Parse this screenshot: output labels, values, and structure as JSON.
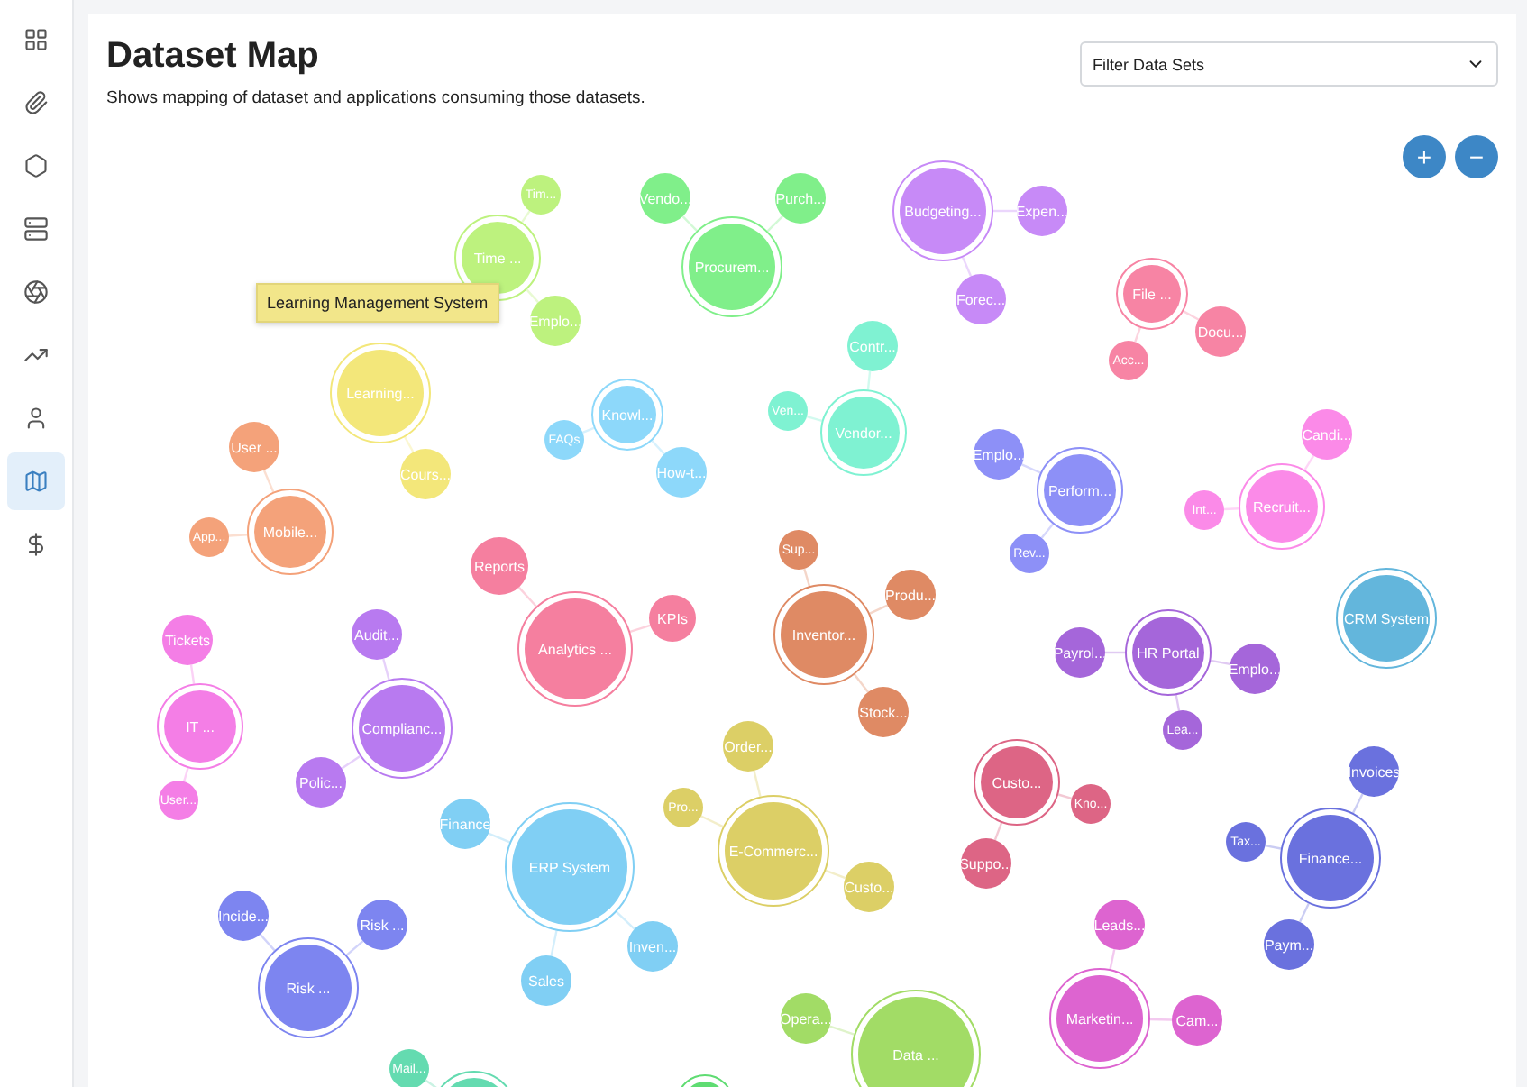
{
  "sidebar": {
    "items": [
      {
        "kind": "grid",
        "selected": false
      },
      {
        "kind": "clip",
        "selected": false
      },
      {
        "kind": "hexagon",
        "selected": false
      },
      {
        "kind": "server",
        "selected": false
      },
      {
        "kind": "aperture",
        "selected": false
      },
      {
        "kind": "trend",
        "selected": false
      },
      {
        "kind": "user",
        "selected": false
      },
      {
        "kind": "map",
        "selected": true
      },
      {
        "kind": "dollar",
        "selected": false
      }
    ]
  },
  "header": {
    "title": "Dataset Map",
    "subtitle": "Shows mapping of dataset and applications consuming those datasets."
  },
  "filter": {
    "placeholder": "Filter Data Sets"
  },
  "zoom_buttons": [
    "+",
    "−"
  ],
  "tooltip": "Learning Management System",
  "clusters": [
    {
      "name": "Time ...",
      "color": "#bdf27e",
      "children": [
        {
          "name": "Tim..."
        },
        {
          "name": "Emplo..."
        }
      ]
    },
    {
      "name": "Learning...",
      "color": "#f3e77a",
      "children": [
        {
          "name": "Cours..."
        }
      ]
    },
    {
      "name": "Mobile...",
      "color": "#f4a27a",
      "children": [
        {
          "name": "User ..."
        },
        {
          "name": "App..."
        }
      ]
    },
    {
      "name": "Procurem...",
      "color": "#80ef8a",
      "children": [
        {
          "name": "Vendo..."
        },
        {
          "name": "Purch..."
        }
      ]
    },
    {
      "name": "Knowl...",
      "color": "#8dd8fa",
      "children": [
        {
          "name": "FAQs"
        },
        {
          "name": "How-t..."
        }
      ]
    },
    {
      "name": "Vendor...",
      "color": "#7ff2d2",
      "children": [
        {
          "name": "Contr..."
        },
        {
          "name": "Ven..."
        }
      ]
    },
    {
      "name": "Budgeting...",
      "color": "#c78af7",
      "children": [
        {
          "name": "Expen..."
        },
        {
          "name": "Forec..."
        }
      ]
    },
    {
      "name": "File ...",
      "color": "#f784a4",
      "children": [
        {
          "name": "Docu..."
        },
        {
          "name": "Acc..."
        }
      ]
    },
    {
      "name": "Perform...",
      "color": "#8d90f7",
      "children": [
        {
          "name": "Emplo..."
        },
        {
          "name": "Rev..."
        }
      ]
    },
    {
      "name": "Recruit...",
      "color": "#fb8ae8",
      "children": [
        {
          "name": "Candi..."
        },
        {
          "name": "Int..."
        }
      ]
    },
    {
      "name": "CRM System",
      "color": "#63b6dc"
    },
    {
      "name": "Analytics ...",
      "color": "#f57f9f",
      "children": [
        {
          "name": "Reports"
        },
        {
          "name": "KPIs"
        }
      ]
    },
    {
      "name": "Inventor...",
      "color": "#df8a64",
      "children": [
        {
          "name": "Sup..."
        },
        {
          "name": "Produ..."
        },
        {
          "name": "Stock..."
        }
      ]
    },
    {
      "name": "IT ...",
      "color": "#f47ee6",
      "children": [
        {
          "name": "Tickets"
        },
        {
          "name": "User..."
        }
      ]
    },
    {
      "name": "Complianc...",
      "color": "#b87af0",
      "children": [
        {
          "name": "Audit..."
        },
        {
          "name": "Polic..."
        }
      ]
    },
    {
      "name": "HR Portal",
      "color": "#a566da",
      "children": [
        {
          "name": "Payrol..."
        },
        {
          "name": "Emplo..."
        },
        {
          "name": "Lea..."
        }
      ]
    },
    {
      "name": "ERP System",
      "color": "#80cff4",
      "children": [
        {
          "name": "Finance"
        },
        {
          "name": "Inven..."
        },
        {
          "name": "Sales"
        }
      ]
    },
    {
      "name": "E-Commerc...",
      "color": "#dccf66",
      "children": [
        {
          "name": "Order..."
        },
        {
          "name": "Pro..."
        },
        {
          "name": "Custo..."
        }
      ]
    },
    {
      "name": "Custo...",
      "color": "#dd6585",
      "children": [
        {
          "name": "Kno..."
        },
        {
          "name": "Suppo..."
        }
      ]
    },
    {
      "name": "Finance...",
      "color": "#6a71de",
      "children": [
        {
          "name": "Invoices"
        },
        {
          "name": "Tax..."
        },
        {
          "name": "Paym..."
        }
      ]
    },
    {
      "name": "Risk ...",
      "color": "#7d85f0",
      "children": [
        {
          "name": "Incide..."
        },
        {
          "name": "Risk ..."
        }
      ]
    },
    {
      "name": "Marketin...",
      "color": "#dd64d0",
      "children": [
        {
          "name": "Leads..."
        },
        {
          "name": "Cam..."
        }
      ]
    },
    {
      "name": "Data ...",
      "color": "#a2dc66",
      "children": [
        {
          "name": "Opera..."
        }
      ]
    },
    {
      "color": "#64dbb0",
      "children": [
        {
          "name": "Mail..."
        }
      ]
    },
    {
      "color": "#5fdc72"
    }
  ]
}
